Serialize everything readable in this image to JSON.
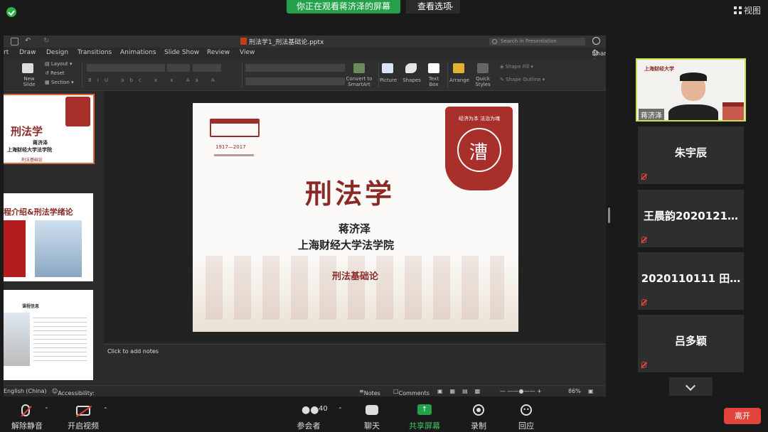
{
  "zoom": {
    "viewing_banner": "你正在观看蒋济泽的屏幕",
    "view_options": "查看选项",
    "grid_view": "视图"
  },
  "ppt": {
    "doc_title": "刑法学1_刑法基础论.pptx",
    "search_placeholder": "Search in Presentation",
    "share": "Share",
    "menu": [
      "rt",
      "Draw",
      "Design",
      "Transitions",
      "Animations",
      "Slide Show",
      "Review",
      "View"
    ],
    "ribbon": {
      "new_slide": "New\nSlide",
      "layout": "Layout",
      "reset": "Reset",
      "section": "Section",
      "convert": "Convert to\nSmartArt",
      "picture": "Picture",
      "shapes": "Shapes",
      "text_box": "Text\nBox",
      "arrange": "Arrange",
      "quick_styles": "Quick\nStyles",
      "shape_fill": "Shape Fill",
      "shape_outline": "Shape Outline"
    },
    "thumbs": {
      "t1_title": "刑法学",
      "t1_name": "蒋济泽",
      "t1_school": "上海财经大学法学院",
      "t1_sub": "刑法基础论",
      "t2_title": "程介绍&刑法学绪论",
      "t3_title": "课程信息"
    },
    "slide": {
      "year": "1917—2017",
      "seal_text": "经济为本 法治为魂",
      "title": "刑法学",
      "name": "蒋济泽",
      "school": "上海财经大学法学院",
      "subtitle": "刑法基础论"
    },
    "notes_placeholder": "Click to add notes",
    "status": {
      "language": "English (China)",
      "accessibility": "Accessibility: Good to go",
      "notes": "Notes",
      "comments": "Comments",
      "zoom": "86%"
    }
  },
  "participants": {
    "video_name": "蒋济泽",
    "video_logo": "上海财经大学",
    "tiles": [
      "朱宇辰",
      "王晨韵2020121…",
      "2020110111 田…",
      "吕多颖"
    ]
  },
  "toolbar": {
    "unmute": "解除静音",
    "start_video": "开启视频",
    "participants": "参会者",
    "participants_count": "40",
    "chat": "聊天",
    "share_screen": "共享屏幕",
    "record": "录制",
    "reactions": "回应",
    "leave": "离开"
  },
  "colors": {
    "zoom_green": "#24a148",
    "leave_red": "#e0443a",
    "slide_red": "#8a2a26",
    "active_speaker": "#c6e24a"
  }
}
